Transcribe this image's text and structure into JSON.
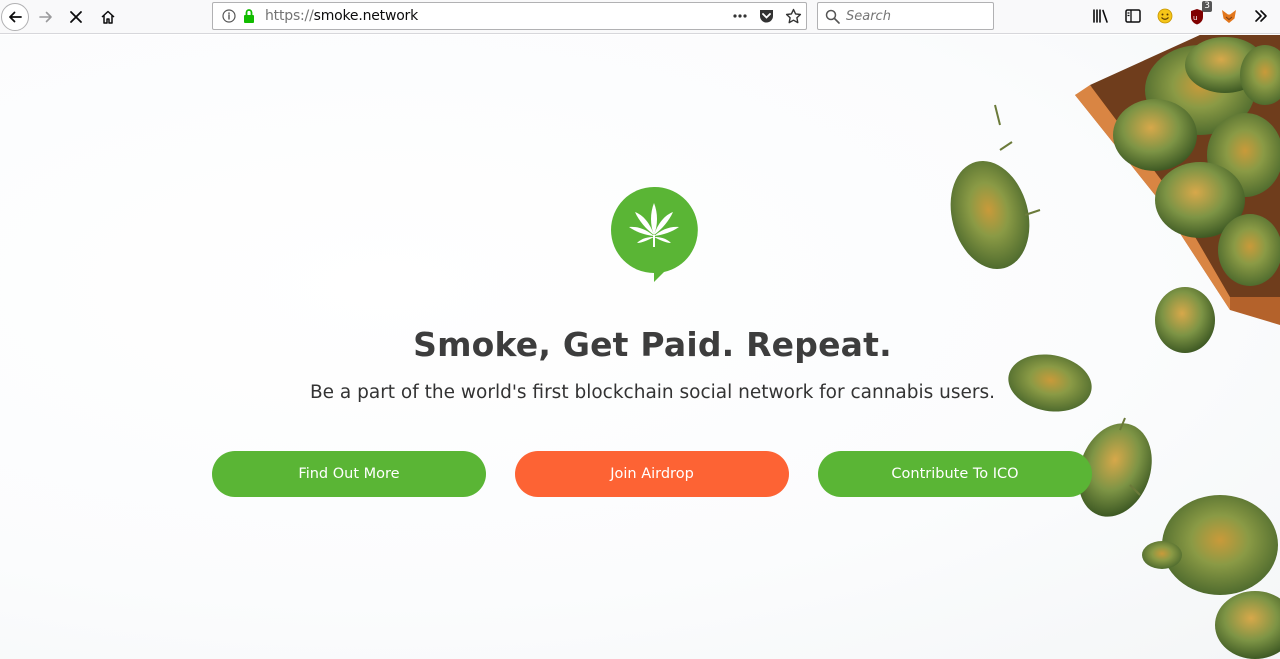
{
  "browser": {
    "url_scheme": "https://",
    "url_host": "smoke.network",
    "search_placeholder": "Search",
    "extension_badge": "3",
    "icons": [
      "back-icon",
      "forward-icon",
      "stop-icon",
      "home-icon",
      "info-icon",
      "lock-icon",
      "more-icon",
      "pocket-icon",
      "bookmark-star-icon",
      "search-icon",
      "library-icon",
      "sidebar-icon",
      "emoji-icon",
      "ublock-icon",
      "metamask-icon",
      "overflow-icon"
    ]
  },
  "hero": {
    "headline": "Smoke, Get Paid. Repeat.",
    "subhead": "Be a part of the world's first blockchain social network for cannabis users.",
    "buttons": {
      "find_out_more": "Find Out More",
      "join_airdrop": "Join Airdrop",
      "contribute": "Contribute To ICO"
    }
  },
  "colors": {
    "brand_green": "#5ab535",
    "cta_orange": "#fd6334",
    "headline": "#3d3d3d"
  }
}
